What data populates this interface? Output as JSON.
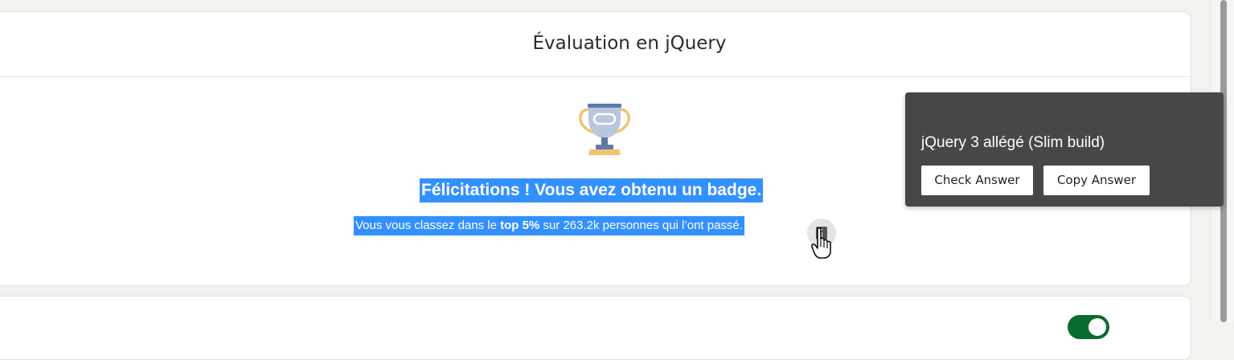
{
  "card": {
    "title": "Évaluation en jQuery",
    "congrats": "Félicitations ! Vous avez obtenu un badge.",
    "ranking": {
      "prefix": "Vous vous classez dans le ",
      "highlight": "top 5%",
      "suffix": " sur 263.2k personnes qui l’ont passé."
    }
  },
  "popup": {
    "answer": "jQuery 3 allégé (Slim build)",
    "check_label": "Check Answer",
    "copy_label": "Copy Answer"
  },
  "icons": {
    "trophy": "trophy-icon",
    "info": "info-icon",
    "cursor": "hand-pointer-icon"
  },
  "colors": {
    "selection": "#3390ff",
    "popup_bg": "#474747",
    "toggle_on": "#0a6b2f"
  }
}
